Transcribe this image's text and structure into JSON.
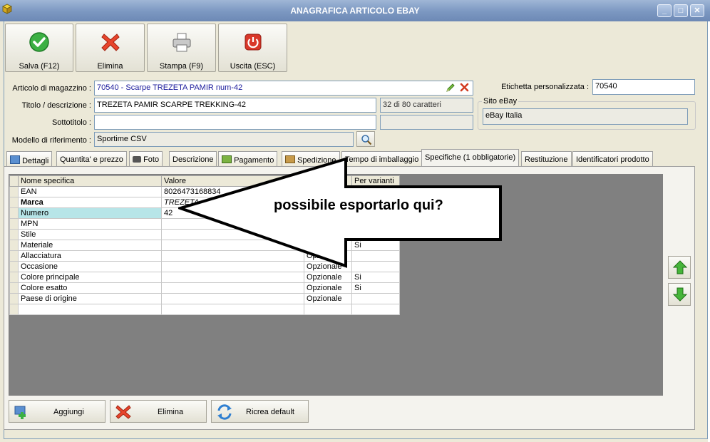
{
  "window": {
    "title": "ANAGRAFICA ARTICOLO EBAY",
    "minimize": "_",
    "maximize": "□",
    "close": "✕"
  },
  "toolbar": {
    "save": "Salva (F12)",
    "delete": "Elimina",
    "print": "Stampa (F9)",
    "exit": "Uscita (ESC)"
  },
  "form": {
    "articolo_label": "Articolo di magazzino :",
    "articolo_value": "70540 - Scarpe TREZETA PAMIR num-42",
    "titolo_label": "Titolo / descrizione :",
    "titolo_value": "TREZETA PAMIR SCARPE TREKKING-42",
    "titolo_count": "32 di 80 caratteri",
    "sottotitolo_label": "Sottotitolo :",
    "sottotitolo_value": "",
    "modello_label": "Modello di riferimento :",
    "modello_value": "Sportime CSV",
    "etichetta_label": "Etichetta personalizzata :",
    "etichetta_value": "70540",
    "sito_label": "Sito eBay",
    "sito_value": "eBay Italia"
  },
  "tabs": [
    "Dettagli",
    "Quantita' e prezzo",
    "Foto",
    "Descrizione",
    "Pagamento",
    "Spedizione",
    "Tempo di imballaggio",
    "Specifiche (1 obbligatorie)",
    "Restituzione",
    "Identificatori prodotto"
  ],
  "grid": {
    "headers": [
      "Nome specifica",
      "Valore",
      "",
      "Per varianti"
    ],
    "rows": [
      {
        "name": "EAN",
        "value": "8026473168834",
        "type": "",
        "var": ""
      },
      {
        "name": "Marca",
        "value": "TREZETA",
        "type": "",
        "var": ""
      },
      {
        "name": "Numero",
        "value": "42",
        "type": "",
        "var": ""
      },
      {
        "name": "MPN",
        "value": "",
        "type": "",
        "var": ""
      },
      {
        "name": "Stile",
        "value": "",
        "type": "",
        "var": ""
      },
      {
        "name": "Materiale",
        "value": "",
        "type": "",
        "var": "Si"
      },
      {
        "name": "Allacciatura",
        "value": "",
        "type": "Opzionale",
        "var": ""
      },
      {
        "name": "Occasione",
        "value": "",
        "type": "Opzionale",
        "var": ""
      },
      {
        "name": "Colore principale",
        "value": "",
        "type": "Opzionale",
        "var": "Si"
      },
      {
        "name": "Colore esatto",
        "value": "",
        "type": "Opzionale",
        "var": "Si"
      },
      {
        "name": "Paese di origine",
        "value": "",
        "type": "Opzionale",
        "var": ""
      }
    ]
  },
  "annotation": {
    "text": "possibile esportarlo qui?"
  },
  "bottom": {
    "add": "Aggiungi",
    "delete": "Elimina",
    "reset": "Ricrea default"
  }
}
